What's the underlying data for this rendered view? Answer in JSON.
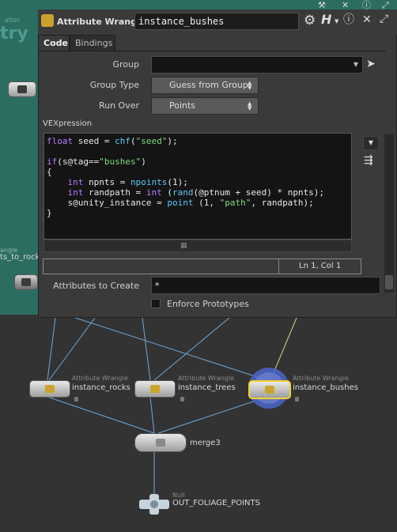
{
  "header": {
    "node_type": "Attribute Wrangle",
    "node_name": "instance_bushes",
    "h_label": "H"
  },
  "tabs": [
    {
      "label": "Code",
      "active": true
    },
    {
      "label": "Bindings",
      "active": false
    }
  ],
  "params": {
    "group_label": "Group",
    "group_value": "",
    "group_type_label": "Group Type",
    "group_type_value": "Guess from Group",
    "run_over_label": "Run Over",
    "run_over_value": "Points",
    "vex_label": "VEXpression",
    "cursor_pos": "Ln 1, Col 1",
    "attributes_label": "Attributes to Create",
    "attributes_value": "*",
    "enforce_label": "Enforce Prototypes",
    "enforce_checked": false
  },
  "code_lines": [
    "float seed = chf(\"seed\");",
    "",
    "if(s@tag==\"bushes\")",
    "{",
    "    int npnts = npoints(1);",
    "    int randpath = int (rand(@ptnum + seed) * npnts);",
    "    s@unity_instance = point (1, \"path\", randpath);",
    "}"
  ],
  "network": {
    "partial_title": "try",
    "partial_label_top": "atter",
    "partial_wrangle_label": "angle",
    "partial_node_label": "ts_to_rock",
    "nodes": [
      {
        "type": "Attribute Wrangle",
        "name": "instance_rocks"
      },
      {
        "type": "Attribute Wrangle",
        "name": "instance_trees"
      },
      {
        "type": "Attribute Wrangle",
        "name": "instance_bushes"
      },
      {
        "type": "",
        "name": "merge3"
      },
      {
        "type": "Null",
        "name": "OUT_FOLIAGE_POINTS"
      }
    ]
  },
  "colors": {
    "teal_bg": "#2c6d62",
    "pane_bg": "#3a3a3a",
    "keyword": "#b47dff",
    "function": "#5ec8f5",
    "string": "#7ed97e",
    "selected_node": "#f2d22e"
  }
}
